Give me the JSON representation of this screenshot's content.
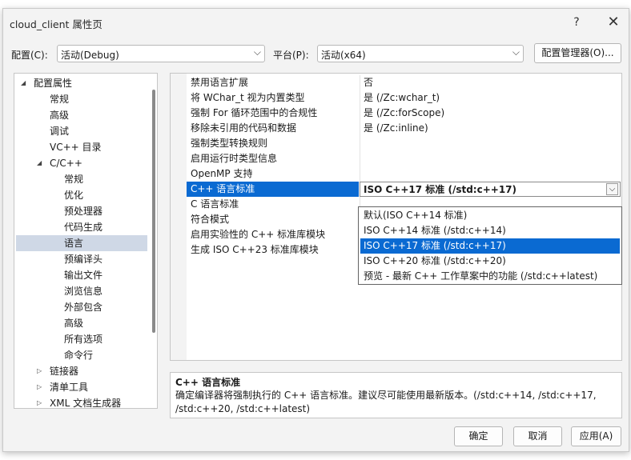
{
  "window": {
    "title": "cloud_client 属性页",
    "help": "?",
    "close": "✕"
  },
  "toolbar": {
    "config_label": "配置(C):",
    "config_value": "活动(Debug)",
    "platform_label": "平台(P):",
    "platform_value": "活动(x64)",
    "config_manager": "配置管理器(O)..."
  },
  "tree": {
    "items": [
      {
        "label": "配置属性",
        "twisty": "◢"
      },
      {
        "label": "常规"
      },
      {
        "label": "高级"
      },
      {
        "label": "调试"
      },
      {
        "label": "VC++ 目录"
      },
      {
        "label": "C/C++",
        "twisty": "◢"
      },
      {
        "label": "常规"
      },
      {
        "label": "优化"
      },
      {
        "label": "预处理器"
      },
      {
        "label": "代码生成"
      },
      {
        "label": "语言",
        "selected": true
      },
      {
        "label": "预编译头"
      },
      {
        "label": "输出文件"
      },
      {
        "label": "浏览信息"
      },
      {
        "label": "外部包含"
      },
      {
        "label": "高级"
      },
      {
        "label": "所有选项"
      },
      {
        "label": "命令行"
      },
      {
        "label": "链接器",
        "twisty": "▷"
      },
      {
        "label": "清单工具",
        "twisty": "▷"
      },
      {
        "label": "XML 文档生成器",
        "twisty": "▷"
      }
    ]
  },
  "properties": [
    {
      "name": "禁用语言扩展",
      "value": "否"
    },
    {
      "name": "将 WChar_t 视为内置类型",
      "value": "是 (/Zc:wchar_t)"
    },
    {
      "name": "强制 For 循环范围中的合规性",
      "value": "是 (/Zc:forScope)"
    },
    {
      "name": "移除未引用的代码和数据",
      "value": "是 (/Zc:inline)"
    },
    {
      "name": "强制类型转换规则",
      "value": ""
    },
    {
      "name": "启用运行时类型信息",
      "value": ""
    },
    {
      "name": "OpenMP 支持",
      "value": ""
    },
    {
      "name": "C++ 语言标准",
      "value": "ISO C++17 标准 (/std:c++17)",
      "selected": true
    },
    {
      "name": "C 语言标准",
      "value": ""
    },
    {
      "name": "符合模式",
      "value": ""
    },
    {
      "name": "启用实验性的 C++ 标准库模块",
      "value": ""
    },
    {
      "name": "生成 ISO C++23 标准库模块",
      "value": ""
    }
  ],
  "dropdown": {
    "options": [
      "默认(ISO C++14 标准)",
      "ISO C++14 标准 (/std:c++14)",
      "ISO C++17 标准 (/std:c++17)",
      "ISO C++20 标准 (/std:c++20)",
      "预览 - 最新 C++ 工作草案中的功能 (/std:c++latest)"
    ],
    "selected_index": 2
  },
  "description": {
    "title": "C++ 语言标准",
    "text": "确定编译器将强制执行的 C++ 语言标准。建议尽可能使用最新版本。(/std:c++14, /std:c++17, /std:c++20, /std:c++latest)"
  },
  "buttons": {
    "ok": "确定",
    "cancel": "取消",
    "apply": "应用(A)"
  },
  "colors": {
    "selection": "#0a6ad2",
    "tree_selection": "#cfd8e6",
    "dialog_bg": "#f3f3f3"
  }
}
